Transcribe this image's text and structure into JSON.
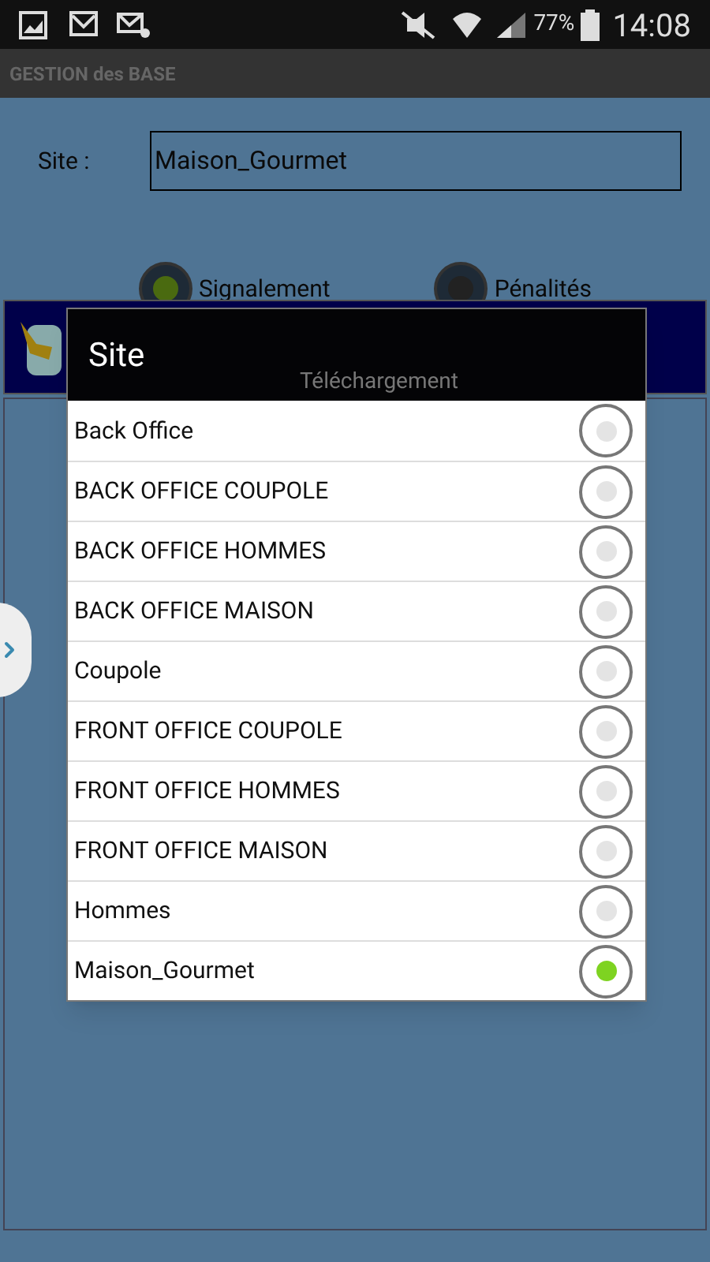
{
  "status_bar": {
    "battery": "77%",
    "time": "14:08"
  },
  "app_bar": {
    "title": "GESTION des BASE"
  },
  "form": {
    "site_label": "Site :",
    "site_value": "Maison_Gourmet"
  },
  "modes": [
    {
      "label": "Signalement",
      "selected": true
    },
    {
      "label": "Pénalités",
      "selected": false
    }
  ],
  "download_panel": {
    "label": "Téléchargement"
  },
  "dialog": {
    "title": "Site",
    "options": [
      {
        "label": "Back Office",
        "selected": false
      },
      {
        "label": "BACK OFFICE COUPOLE",
        "selected": false
      },
      {
        "label": "BACK OFFICE HOMMES",
        "selected": false
      },
      {
        "label": "BACK OFFICE MAISON",
        "selected": false
      },
      {
        "label": "Coupole",
        "selected": false
      },
      {
        "label": "FRONT OFFICE COUPOLE",
        "selected": false
      },
      {
        "label": "FRONT OFFICE HOMMES",
        "selected": false
      },
      {
        "label": "FRONT OFFICE MAISON",
        "selected": false
      },
      {
        "label": "Hommes",
        "selected": false
      },
      {
        "label": "Maison_Gourmet",
        "selected": true
      }
    ]
  }
}
